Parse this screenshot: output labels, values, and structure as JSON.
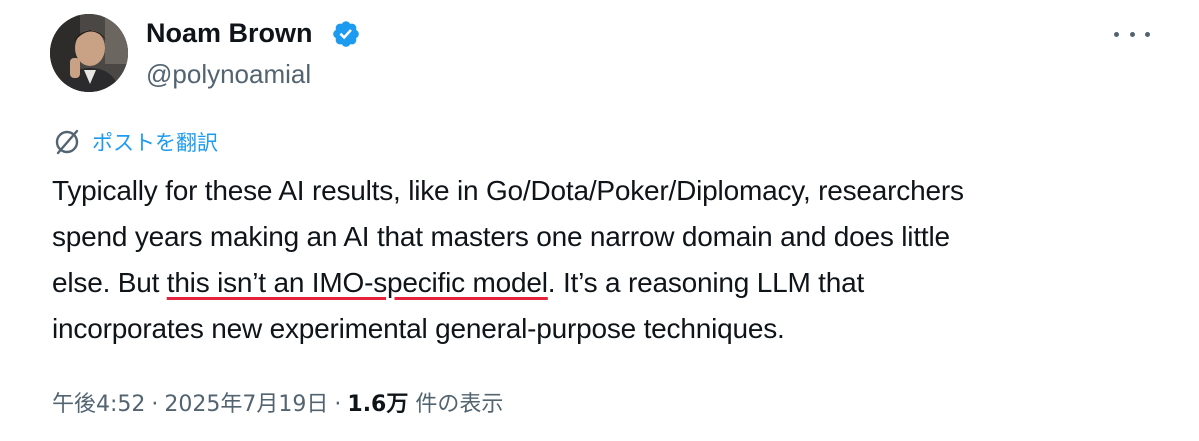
{
  "author": {
    "name": "Noam Brown",
    "handle": "@polynoamial",
    "verified": true,
    "verified_color": "#1d9bf0"
  },
  "translate": {
    "label": "ポストを翻訳",
    "icon": "translate-icon"
  },
  "post": {
    "line1": "Typically for these AI results, like in Go/Dota/Poker/Diplomacy, researchers",
    "line2": "spend years making an AI that masters one narrow domain and does little",
    "line3_before": "else. But ",
    "line3_underlined": "this isn’t an IMO-specific model",
    "line3_after": ". It’s a reasoning LLM that",
    "line4": "incorporates new experimental general-purpose techniques.",
    "underline_color": "#e5233d"
  },
  "meta": {
    "time": "午後4:52",
    "date": "2025年7月19日",
    "views_count": "1.6万",
    "views_label": "件の表示",
    "separator": "·"
  },
  "menu": {
    "icon": "more-options-icon"
  },
  "colors": {
    "text": "#0f1419",
    "secondary": "#536471",
    "accent": "#1d9bf0"
  }
}
